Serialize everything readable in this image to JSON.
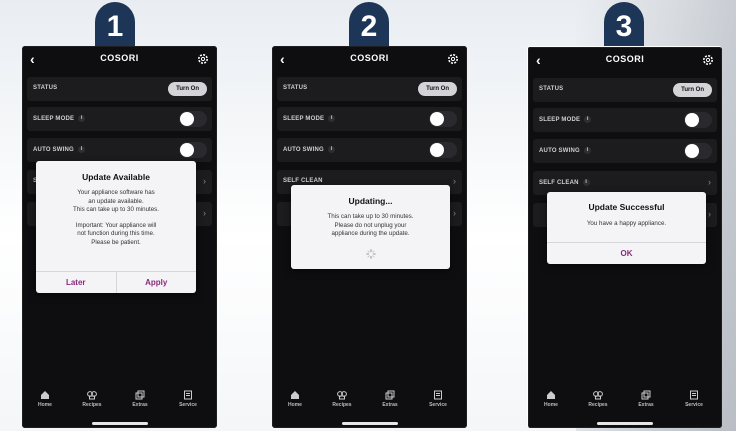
{
  "app": {
    "brand": "COSORI",
    "status_label": "STATUS",
    "turn_on_label": "Turn On",
    "sleep_mode_label": "SLEEP MODE",
    "auto_swing_label": "AUTO SWING",
    "self_clean_label": "SELF CLEAN",
    "info_glyph": "i",
    "tabs": [
      "Home",
      "Recipes",
      "Extras",
      "Service"
    ]
  },
  "steps": [
    {
      "number": "1",
      "dialog": {
        "title": "Update Available",
        "body": [
          "Your appliance software has",
          "an update available.",
          "This can take up to 30 minutes."
        ],
        "note": [
          "Important: Your appliance will",
          "not function during this time.",
          "Please be patient."
        ],
        "button_later": "Later",
        "button_apply": "Apply"
      }
    },
    {
      "number": "2",
      "dialog": {
        "title": "Updating...",
        "body": [
          "This can take up to 30 minutes.",
          "Please do not unplug your",
          "appliance during the update."
        ]
      }
    },
    {
      "number": "3",
      "dialog": {
        "title": "Update Successful",
        "body": [
          "You have a happy appliance."
        ],
        "button_ok": "OK"
      }
    }
  ],
  "colors": {
    "badge": "#1d3557",
    "accent": "#8b2a7d",
    "phone_bg": "#0e0e10"
  }
}
